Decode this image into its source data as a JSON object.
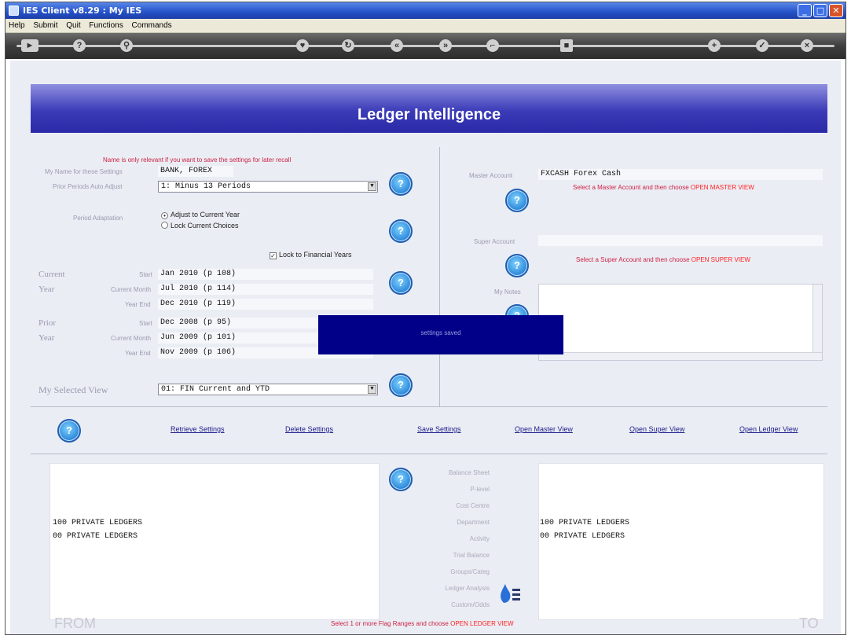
{
  "window": {
    "title": "IES Client v8.29 : My IES"
  },
  "menu": [
    "Help",
    "Submit",
    "Quit",
    "Functions",
    "Commands"
  ],
  "banner": {
    "title": "Ledger Intelligence"
  },
  "left": {
    "hint": "Name is only relevant if you want to save the settings for later recall",
    "name_label": "My Name for these Settings",
    "name_value": "BANK, FOREX",
    "prior_label": "Prior Periods Auto Adjust",
    "prior_value": "1: Minus 13 Periods",
    "period_adapt_label": "Period Adaptation",
    "opt_adjust": "Adjust to Current Year",
    "opt_lock": "Lock Current Choices",
    "opt_financial": "Lock to Financial Years",
    "current_label": "Current",
    "year_label": "Year",
    "prior_label2": "Prior",
    "start_label": "Start",
    "current_month_label": "Current Month",
    "year_end_label": "Year End",
    "cur_start": "Jan 2010 (p 108)",
    "cur_month": "Jul 2010 (p 114)",
    "cur_end": "Dec 2010 (p 119)",
    "pri_start": "Dec 2008 (p 95)",
    "pri_month": "Jun 2009 (p 101)",
    "pri_end": "Nov 2009 (p 106)",
    "view_label": "My Selected View",
    "view_value": "01: FIN Current and YTD"
  },
  "right": {
    "master_label": "Master Account",
    "master_value": "FXCASH Forex Cash",
    "master_hint": "Select a Master Account and then choose",
    "master_hint_hl": "OPEN MASTER VIEW",
    "super_label": "Super Account",
    "super_hint": "Select a Super Account and then choose",
    "super_hint_hl": "OPEN SUPER VIEW",
    "notes_label": "My Notes"
  },
  "toast": "settings saved",
  "actions": [
    "Retrieve Settings",
    "Delete Settings",
    "Save Settings",
    "Open Master View",
    "Open Super View",
    "Open Ledger View"
  ],
  "bottom": {
    "from_line1": "100 PRIVATE LEDGERS",
    "from_line2": "00 PRIVATE LEDGERS",
    "to_line1": "100 PRIVATE LEDGERS",
    "to_line2": "00 PRIVATE LEDGERS",
    "flags": [
      "Balance Sheet",
      "P-level",
      "Cost Centre",
      "Department",
      "Activity",
      "Trial Balance",
      "Groups/Categ",
      "Ledger Analysis",
      "Custom/Odds"
    ],
    "footer_hint": "Select 1 or more Flag Ranges and choose",
    "footer_hint_hl": "OPEN LEDGER VIEW",
    "from": "FROM",
    "to": "TO"
  }
}
